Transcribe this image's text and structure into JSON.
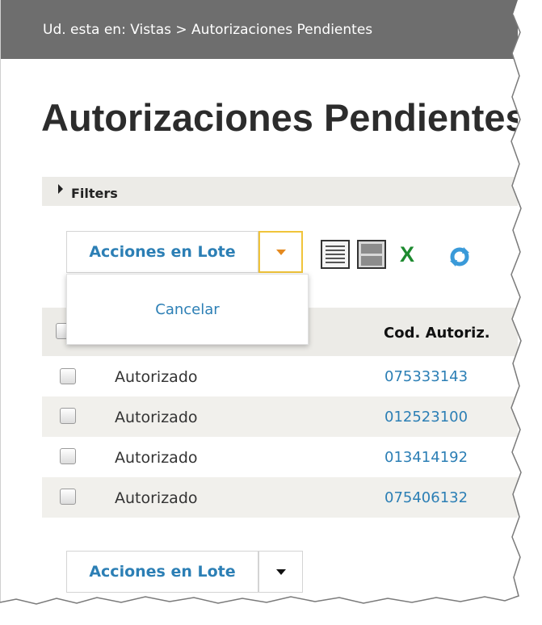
{
  "breadcrumb": {
    "text": "Ud. esta en: Vistas > Autorizaciones Pendientes"
  },
  "page": {
    "title": "Autorizaciones Pendientes"
  },
  "filters": {
    "label": "Filters"
  },
  "toolbar": {
    "batch_label": "Acciones en Lote",
    "icons": [
      "list-view-icon",
      "grid-view-icon",
      "excel-export-icon",
      "refresh-icon"
    ],
    "dropdown_items": [
      "Cancelar"
    ]
  },
  "table": {
    "columns": [
      "",
      "",
      "Cod. Autoriz."
    ],
    "rows": [
      {
        "status": "Autorizado",
        "code": "075333143"
      },
      {
        "status": "Autorizado",
        "code": "012523100"
      },
      {
        "status": "Autorizado",
        "code": "013414192"
      },
      {
        "status": "Autorizado",
        "code": "075406132"
      }
    ]
  },
  "bottom_toolbar": {
    "batch_label": "Acciones en Lote"
  },
  "colors": {
    "header": "#6e6e6e",
    "link": "#2c7fb5",
    "accent": "#f0c43a",
    "caret": "#e58a1f"
  }
}
